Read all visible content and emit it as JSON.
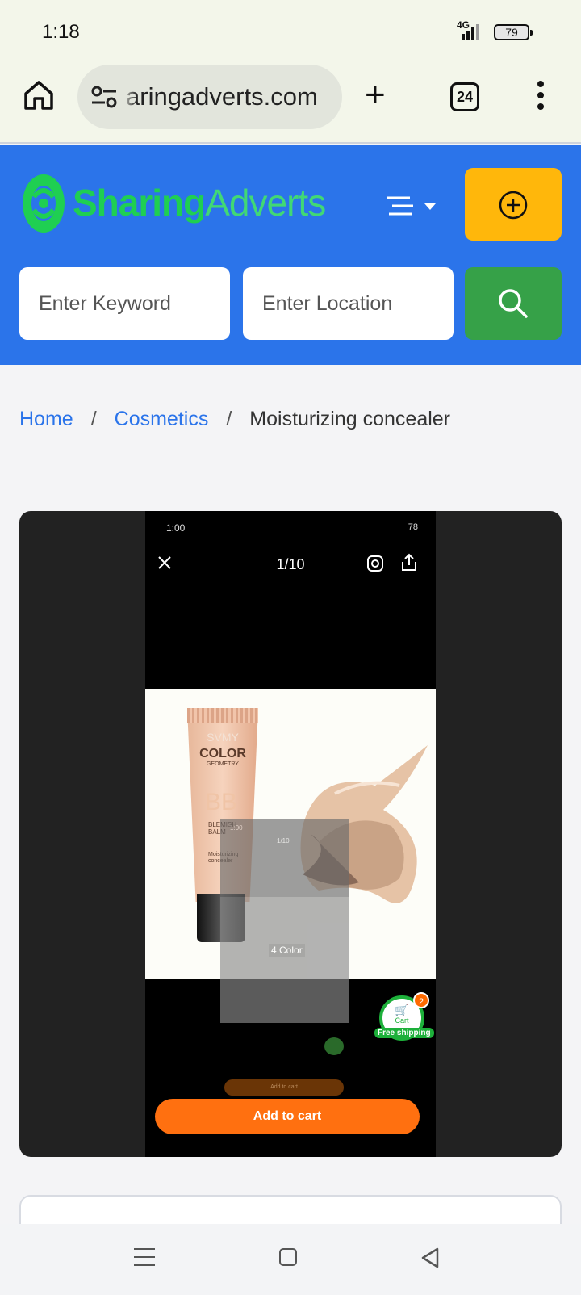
{
  "status_bar": {
    "time": "1:18",
    "network": "4G",
    "battery": "79"
  },
  "browser": {
    "url": "aringadverts.com",
    "tab_count": "24"
  },
  "header": {
    "logo_bold": "Sharing",
    "logo_light": "Adverts",
    "search": {
      "keyword_placeholder": "Enter Keyword",
      "location_placeholder": "Enter Location"
    },
    "accent_blue": "#2b74ea",
    "post_button_color": "#ffb70b",
    "search_button_color": "#36a148"
  },
  "breadcrumb": {
    "home": "Home",
    "category": "Cosmetics",
    "current": "Moisturizing concealer",
    "separator": "/"
  },
  "gallery": {
    "screenshot": {
      "status_time": "1:00",
      "status_battery": "78",
      "counter": "1/10",
      "overlay_counter": "1/10",
      "overlay_time": "1:00",
      "color_tag": "4 Color",
      "cart_label": "Cart",
      "cart_count": "2",
      "free_shipping": "Free shipping",
      "ghost_button": "Add to cart",
      "add_to_cart": "Add to cart",
      "product": {
        "brand": "SVMY",
        "name": "COLOR",
        "subname": "GEOMETRY",
        "bb": "BB",
        "balm": "BLEMISH\nBALM",
        "desc": "Moisturizing\nconcealer"
      }
    }
  }
}
